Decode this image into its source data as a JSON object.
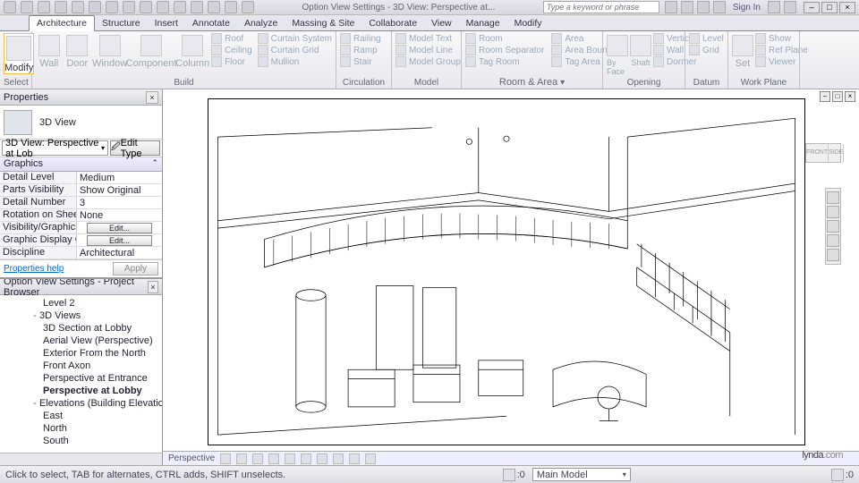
{
  "title": "Option View Settings - 3D View: Perspective at...",
  "search_placeholder": "Type a keyword or phrase",
  "sign_in": "Sign In",
  "menu_tabs": [
    "Architecture",
    "Structure",
    "Insert",
    "Annotate",
    "Analyze",
    "Massing & Site",
    "Collaborate",
    "View",
    "Manage",
    "Modify"
  ],
  "active_tab": 0,
  "ribbon": {
    "select": {
      "modify": "Modify",
      "label": "Select"
    },
    "build": {
      "label": "Build",
      "items": [
        "Wall",
        "Door",
        "Window",
        "Component",
        "Column"
      ],
      "small": [
        [
          "Roof",
          "Curtain System",
          "Model Text"
        ],
        [
          "Ceiling",
          "Curtain Grid",
          "Model Line"
        ],
        [
          "Floor",
          "Mullion"
        ]
      ],
      "extra": [
        [
          "Railing"
        ],
        [
          "Ramp"
        ],
        [
          "Stair"
        ]
      ]
    },
    "model": {
      "label": "Model",
      "group": "Model Group"
    },
    "circ": {
      "label": "Circulation"
    },
    "room": {
      "label": "Room & Area",
      "items": [
        [
          "Room",
          "Area"
        ],
        [
          "Room Separator",
          "Area Boundary"
        ],
        [
          "Tag Room",
          "Tag Area"
        ]
      ]
    },
    "opening": {
      "label": "Opening",
      "items": [
        "By Face",
        "Shaft",
        "Vertical",
        "Wall",
        "Dormer"
      ]
    },
    "datum": {
      "label": "Datum",
      "items": [
        "Level",
        "Grid"
      ]
    },
    "workplane": {
      "label": "Work Plane",
      "items": [
        "Set",
        "Show",
        "Ref Plane",
        "Viewer"
      ]
    }
  },
  "properties": {
    "title": "Properties",
    "type": "3D View",
    "instance": "3D View: Perspective at Lob",
    "edit_type": "Edit Type",
    "group": "Graphics",
    "rows": [
      {
        "name": "Detail Level",
        "value": "Medium"
      },
      {
        "name": "Parts Visibility",
        "value": "Show Original"
      },
      {
        "name": "Detail Number",
        "value": "3"
      },
      {
        "name": "Rotation on Sheet",
        "value": "None"
      },
      {
        "name": "Visibility/Graphics...",
        "value": "Edit...",
        "btn": true
      },
      {
        "name": "Graphic Display O...",
        "value": "Edit...",
        "btn": true
      },
      {
        "name": "Discipline",
        "value": "Architectural"
      }
    ],
    "help": "Properties help",
    "apply": "Apply"
  },
  "browser": {
    "title": "Option View Settings - Project Browser",
    "nodes": [
      {
        "l": 3,
        "t": "Level 2"
      },
      {
        "l": 2,
        "t": "3D Views",
        "tw": "-"
      },
      {
        "l": 3,
        "t": "3D Section at Lobby"
      },
      {
        "l": 3,
        "t": "Aerial View (Perspective)"
      },
      {
        "l": 3,
        "t": "Exterior From the North"
      },
      {
        "l": 3,
        "t": "Front Axon"
      },
      {
        "l": 3,
        "t": "Perspective at Entrance"
      },
      {
        "l": 3,
        "t": "Perspective at Lobby",
        "bold": true
      },
      {
        "l": 2,
        "t": "Elevations (Building Elevation)",
        "tw": "-"
      },
      {
        "l": 3,
        "t": "East"
      },
      {
        "l": 3,
        "t": "North"
      },
      {
        "l": 3,
        "t": "South"
      }
    ]
  },
  "viewctrl": {
    "name": "Perspective"
  },
  "navcube": [
    "FRONT",
    "SIDE"
  ],
  "status": {
    "hint": "Click to select, TAB for alternates, CTRL adds, SHIFT unselects.",
    "combo": "Main Model",
    "zero": ":0"
  },
  "watermark": {
    "a": "lynda",
    "b": ".com"
  }
}
